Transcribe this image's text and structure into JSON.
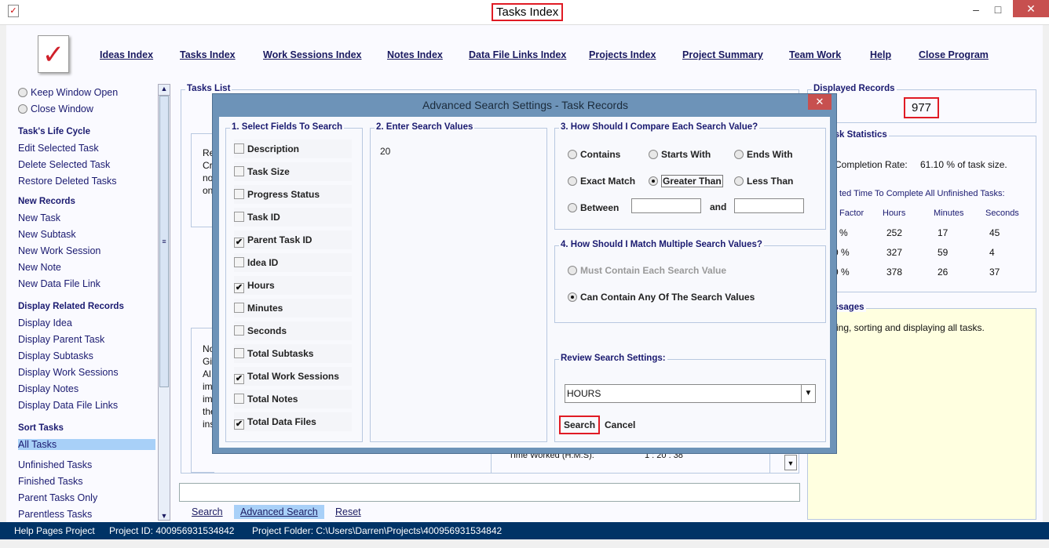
{
  "window": {
    "title": "Tasks Index",
    "minimize": "–",
    "maximize": "□",
    "close": "✕"
  },
  "nav": [
    "Ideas Index",
    "Tasks Index",
    "Work Sessions Index",
    "Notes Index",
    "Data File Links Index",
    "Projects Index",
    "Project Summary",
    "Team Work",
    "Help",
    "Close Program"
  ],
  "sidebar": {
    "radios": [
      {
        "label": "Keep Window Open",
        "checked": false
      },
      {
        "label": "Close Window",
        "checked": false
      }
    ],
    "sections": [
      {
        "title": "Task's Life Cycle",
        "items": [
          "Edit Selected Task",
          "Delete Selected Task",
          "Restore Deleted Tasks"
        ]
      },
      {
        "title": "New Records",
        "items": [
          "New Task",
          "New Subtask",
          "New Work Session",
          "New Note",
          "New Data File Link"
        ]
      },
      {
        "title": "Display Related Records",
        "items": [
          "Display Idea",
          "Display Parent Task",
          "Display Subtasks",
          "Display Work Sessions",
          "Display Notes",
          "Display Data File Links"
        ]
      },
      {
        "title": "Sort Tasks",
        "items": [
          "All Tasks",
          "Unfinished Tasks",
          "Finished Tasks",
          "Parent Tasks Only",
          "Parentless Tasks"
        ]
      }
    ],
    "selected": "All Tasks"
  },
  "tasks_list": {
    "title": "Tasks List",
    "partial_text_1": [
      "Re",
      "Cr",
      "no",
      "on"
    ],
    "partial_text_2": [
      "No",
      "Gi",
      "Al",
      "im",
      "im",
      "the",
      "ins"
    ],
    "time_worked_label": "Time Worked (H:M:S):",
    "time_worked_value": "1 : 20 : 38"
  },
  "search_bar": {
    "value": "",
    "buttons": [
      "Search",
      "Advanced Search",
      "Reset"
    ]
  },
  "displayed_records": {
    "title": "Displayed Records",
    "value": "977"
  },
  "statistics": {
    "title": "nt Task Statistics",
    "completion_label": "Completion Rate:",
    "completion_value": "61.10 % of task size.",
    "estimated_label": "ted Time To Complete All Unfinished Tasks:",
    "headers": [
      "Factor",
      "Hours",
      "Minutes",
      "Seconds"
    ],
    "rows": [
      [
        "%",
        "252",
        "17",
        "45"
      ],
      [
        "0 %",
        "327",
        "59",
        "4"
      ],
      [
        "0 %",
        "378",
        "26",
        "37"
      ]
    ]
  },
  "messages": {
    "title": "s Messages",
    "text": "ing, sorting and displaying all tasks."
  },
  "status_bar": {
    "project": "Help Pages Project",
    "project_id": "Project ID:  400956931534842",
    "folder": "Project Folder:  C:\\Users\\Darren\\Projects\\400956931534842"
  },
  "dialog": {
    "title": "Advanced Search Settings - Task Records",
    "close": "✕",
    "fields_title": "1. Select Fields To Search",
    "fields": [
      {
        "label": "Description",
        "checked": false
      },
      {
        "label": "Task Size",
        "checked": false
      },
      {
        "label": "Progress Status",
        "checked": false
      },
      {
        "label": "Task ID",
        "checked": false
      },
      {
        "label": "Parent Task ID",
        "checked": true
      },
      {
        "label": "Idea ID",
        "checked": false
      },
      {
        "label": "Hours",
        "checked": true
      },
      {
        "label": "Minutes",
        "checked": false
      },
      {
        "label": "Seconds",
        "checked": false
      },
      {
        "label": "Total Subtasks",
        "checked": false
      },
      {
        "label": "Total Work Sessions",
        "checked": true
      },
      {
        "label": "Total Notes",
        "checked": false
      },
      {
        "label": "Total Data Files",
        "checked": true
      }
    ],
    "values_title": "2. Enter Search Values",
    "values": "20",
    "compare_title": "3. How Should I Compare Each Search Value?",
    "compare": [
      {
        "label": "Contains",
        "checked": false
      },
      {
        "label": "Starts With",
        "checked": false
      },
      {
        "label": "Ends With",
        "checked": false
      },
      {
        "label": "Exact Match",
        "checked": false
      },
      {
        "label": "Greater Than",
        "checked": true
      },
      {
        "label": "Less Than",
        "checked": false
      },
      {
        "label": "Between",
        "checked": false
      }
    ],
    "between_and": "and",
    "between_from": "",
    "between_to": "",
    "match_title": "4. How Should I Match Multiple Search Values?",
    "match": [
      {
        "label": "Must Contain Each Search Value",
        "checked": false,
        "disabled": true
      },
      {
        "label": "Can Contain Any Of The Search Values",
        "checked": true
      }
    ],
    "review_title": "Review Search Settings:",
    "review_value": "HOURS",
    "search": "Search",
    "cancel": "Cancel"
  }
}
